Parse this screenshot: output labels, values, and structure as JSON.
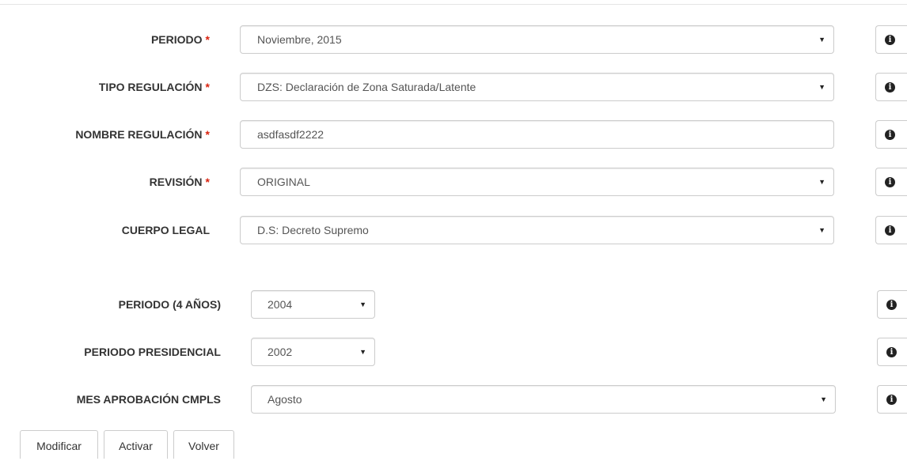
{
  "form": {
    "periodo": {
      "label": "PERIODO",
      "required_mark": "*",
      "value": "Noviembre, 2015"
    },
    "tipo_regulacion": {
      "label": "TIPO REGULACIÓN",
      "required_mark": "*",
      "value": "DZS: Declaración de Zona Saturada/Latente"
    },
    "nombre_regulacion": {
      "label": "NOMBRE REGULACIÓN",
      "required_mark": "*",
      "value": "asdfasdf2222"
    },
    "revision": {
      "label": "REVISIÓN",
      "required_mark": "*",
      "value": "ORIGINAL"
    },
    "cuerpo_legal": {
      "label": "CUERPO LEGAL",
      "value": "D.S: Decreto Supremo"
    },
    "periodo_4_anos": {
      "label": "PERIODO (4 AÑOS)",
      "value": "2004"
    },
    "periodo_presidencial": {
      "label": "PERIODO PRESIDENCIAL",
      "value": "2002"
    },
    "mes_aprobacion": {
      "label": "MES APROBACIÓN CMPLS",
      "value": "Agosto"
    }
  },
  "icons": {
    "info": "info-circle-icon",
    "caret": "caret-down-icon"
  },
  "colors": {
    "required": "#d9230f",
    "border": "#cccccc"
  },
  "glyphs": {
    "caret": "▼",
    "info": "i"
  },
  "buttons": {
    "modificar": "Modificar",
    "activar": "Activar",
    "volver": "Volver"
  }
}
